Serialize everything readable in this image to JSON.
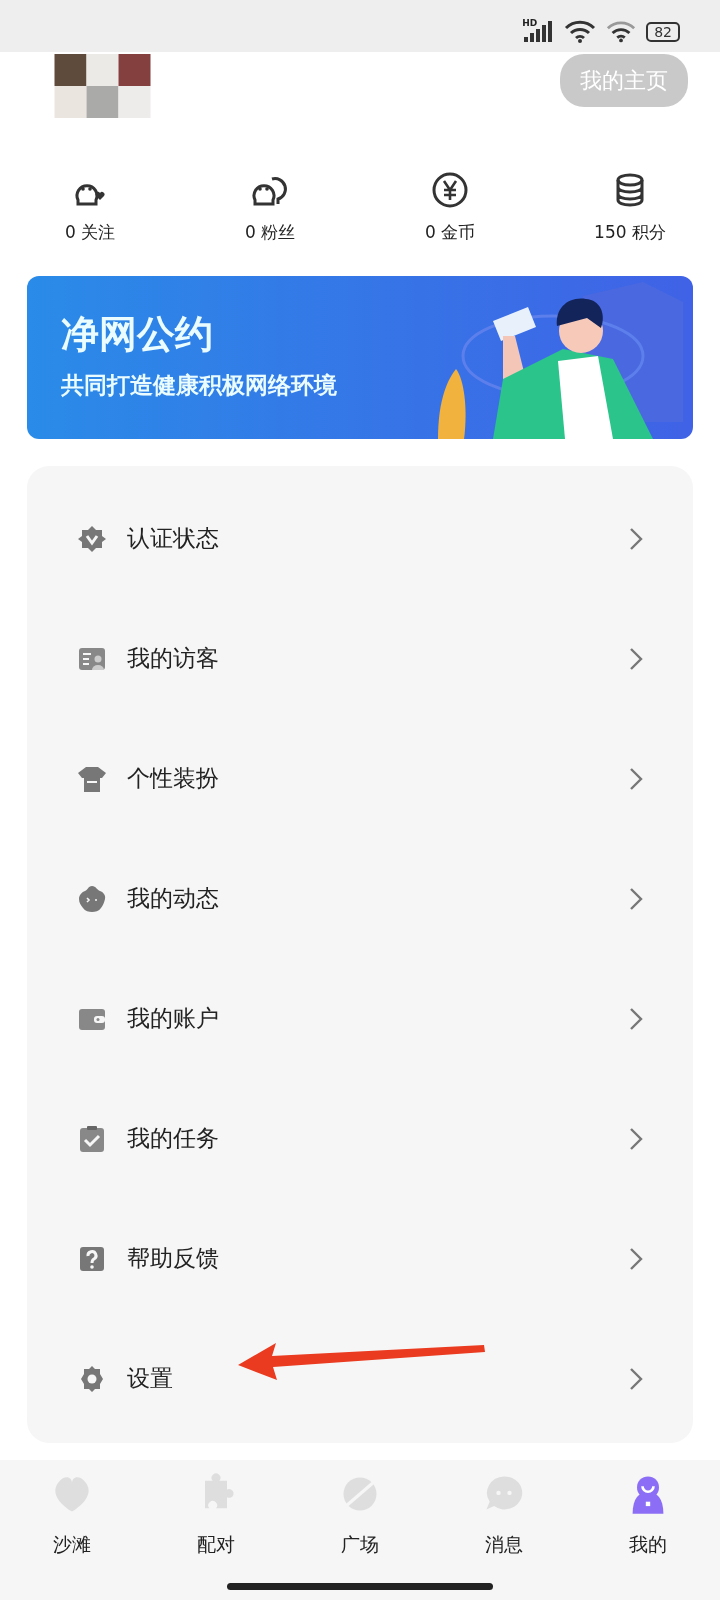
{
  "status_bar": {
    "network": "HD",
    "battery": "82"
  },
  "header": {
    "homepage_button": "我的主页"
  },
  "stats": [
    {
      "kind": "follow",
      "label": "0 关注"
    },
    {
      "kind": "fans",
      "label": "0 粉丝"
    },
    {
      "kind": "coins",
      "label": "0 金币"
    },
    {
      "kind": "points",
      "label": "150 积分"
    }
  ],
  "banner": {
    "title": "净网公约",
    "subtitle": "共同打造健康积极网络环境"
  },
  "menu": [
    {
      "kind": "verify",
      "label": "认证状态"
    },
    {
      "kind": "visitors",
      "label": "我的访客"
    },
    {
      "kind": "outfit",
      "label": "个性装扮"
    },
    {
      "kind": "moments",
      "label": "我的动态"
    },
    {
      "kind": "wallet",
      "label": "我的账户"
    },
    {
      "kind": "tasks",
      "label": "我的任务"
    },
    {
      "kind": "help",
      "label": "帮助反馈"
    },
    {
      "kind": "settings",
      "label": "设置",
      "annotated": true
    }
  ],
  "tabs": [
    {
      "kind": "beach",
      "label": "沙滩",
      "selected": false
    },
    {
      "kind": "match",
      "label": "配对",
      "selected": false
    },
    {
      "kind": "plaza",
      "label": "广场",
      "selected": false
    },
    {
      "kind": "messages",
      "label": "消息",
      "selected": false
    },
    {
      "kind": "me",
      "label": "我的",
      "selected": true
    }
  ]
}
